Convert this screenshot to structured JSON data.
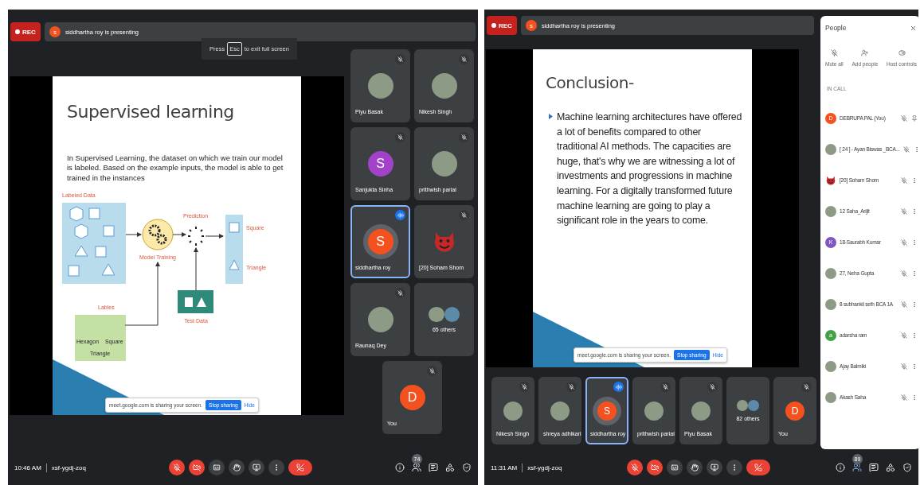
{
  "screens": [
    {
      "rec": "REC",
      "presenter_initial": "s",
      "presenter": "siddhartha roy is presenting",
      "fullscreen_hint": {
        "press": "Press",
        "key": "Esc",
        "rest": "to exit full screen"
      },
      "slide": {
        "kind": "diagram",
        "title": "Supervised learning",
        "text": "In Supervised Learning, the dataset on which we train our model is labeled. Based on the example inputs, the model is able to get trained in the instances",
        "diagram": {
          "labeled_data": "Labeled Data",
          "model_training": "Model Training",
          "prediction": "Prediction",
          "square": "Square",
          "triangle": "Triangle",
          "labels": "Lables",
          "label_hexagon": "Hexagon",
          "label_square": "Square",
          "label_triangle": "Triangle",
          "test_data": "Test Data"
        }
      },
      "share_bar": {
        "message": "meet.google.com is sharing your screen.",
        "stop": "Stop sharing",
        "hide": "Hide"
      },
      "tiles": [
        {
          "name": "Piyu Basak",
          "kind": "photo",
          "muted": true,
          "speaking": false
        },
        {
          "name": "Nikesh Singh",
          "kind": "photo",
          "muted": true,
          "speaking": false
        },
        {
          "name": "Sanjukta Sinha",
          "kind": "letter",
          "initial": "S",
          "color": "#a142c8",
          "muted": true,
          "speaking": false
        },
        {
          "name": "prithwish parial",
          "kind": "photo",
          "muted": true,
          "speaking": false
        },
        {
          "name": "siddhartha roy",
          "kind": "letter",
          "initial": "S",
          "color": "#f4511e",
          "muted": false,
          "speaking": true
        },
        {
          "name": "[20] Soham Shom",
          "kind": "emoji",
          "muted": true,
          "speaking": false
        },
        {
          "name": "Raunaq Dey",
          "kind": "photo",
          "muted": true,
          "speaking": false
        },
        {
          "name": "65 others",
          "kind": "group",
          "muted": false,
          "speaking": false
        },
        {
          "name": "You",
          "kind": "letter",
          "initial": "D",
          "color": "#f4511e",
          "muted": true,
          "speaking": false
        }
      ],
      "time": "10:46 AM",
      "meeting_code": "xsf-ygdj-zoq",
      "controls": [
        {
          "kind": "mic",
          "off": true
        },
        {
          "kind": "camera",
          "off": true
        },
        {
          "kind": "captions",
          "off": false
        },
        {
          "kind": "hand",
          "off": false
        },
        {
          "kind": "present",
          "off": false
        },
        {
          "kind": "more",
          "off": false
        },
        {
          "kind": "end"
        }
      ],
      "people_count": "74"
    },
    {
      "rec": "REC",
      "presenter_initial": "s",
      "presenter": "siddhartha roy is presenting",
      "slide": {
        "kind": "bullets",
        "title": "Conclusion-",
        "bullets": [
          "Machine learning architectures have offered a lot of benefits compared to other traditional AI methods. The capacities are huge, that's why we are witnessing a lot of investments and progressions in machine learning. For a digitally transformed future machine learning are going to play a significant role in the years to come."
        ]
      },
      "share_bar": {
        "message": "meet.google.com is sharing your screen.",
        "stop": "Stop sharing",
        "hide": "Hide"
      },
      "tiles": [
        {
          "name": "Nikesh Singh",
          "kind": "photo",
          "muted": true,
          "speaking": false
        },
        {
          "name": "shreya adhikari",
          "kind": "photo",
          "muted": true,
          "speaking": false
        },
        {
          "name": "siddhartha roy",
          "kind": "letter",
          "initial": "S",
          "color": "#f4511e",
          "muted": false,
          "speaking": true
        },
        {
          "name": "prithwish parial",
          "kind": "photo",
          "muted": true,
          "speaking": false
        },
        {
          "name": "Piyu Basak",
          "kind": "photo",
          "muted": true,
          "speaking": false
        },
        {
          "name": "82 others",
          "kind": "group",
          "muted": false,
          "speaking": false
        },
        {
          "name": "You",
          "kind": "letter",
          "initial": "D",
          "color": "#f4511e",
          "muted": true,
          "speaking": false
        }
      ],
      "people_panel": {
        "title": "People",
        "actions": [
          {
            "kind": "mute",
            "label": "Mute all"
          },
          {
            "kind": "add",
            "label": "Add people"
          },
          {
            "kind": "host",
            "label": "Host controls"
          }
        ],
        "section": "IN CALL",
        "people": [
          {
            "name": "DEBRUPA PAL (You)",
            "kind": "letter",
            "initial": "D",
            "color": "#f4511e",
            "self": true
          },
          {
            "name": "[ 24 ] - Ayan Biswas _BCA...",
            "kind": "photo",
            "self": false
          },
          {
            "name": "[20] Soham Shom",
            "kind": "emoji",
            "self": false
          },
          {
            "name": "12 Saha_Arijit",
            "kind": "photo",
            "self": false
          },
          {
            "name": "18-Saurabh Kumar",
            "kind": "letter",
            "initial": "K",
            "color": "#7e57c2",
            "self": false
          },
          {
            "name": "27, Neha Gupta",
            "kind": "photo",
            "self": false
          },
          {
            "name": "8 subhankii seth BCA 1A",
            "kind": "photo",
            "self": false
          },
          {
            "name": "adarsha ram",
            "kind": "letter",
            "initial": "a",
            "color": "#43a047",
            "self": false
          },
          {
            "name": "Ajay Balmiki",
            "kind": "photo",
            "self": false
          },
          {
            "name": "Akash Saha",
            "kind": "photo",
            "self": false
          }
        ]
      },
      "time": "11:31 AM",
      "meeting_code": "xsf-ygdj-zoq",
      "controls": [
        {
          "kind": "mic",
          "off": true
        },
        {
          "kind": "camera",
          "off": true
        },
        {
          "kind": "captions",
          "off": false
        },
        {
          "kind": "hand",
          "off": false
        },
        {
          "kind": "present",
          "off": false
        },
        {
          "kind": "more",
          "off": false
        },
        {
          "kind": "end"
        }
      ],
      "people_count": "89"
    }
  ]
}
